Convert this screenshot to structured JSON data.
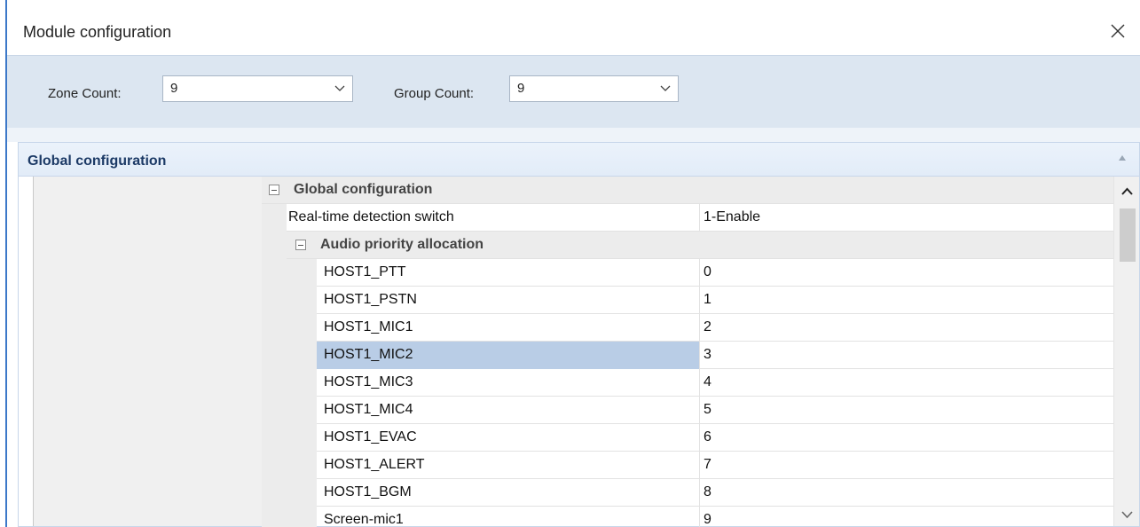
{
  "window": {
    "title": "Module configuration",
    "close_icon": "close-icon"
  },
  "counts": {
    "zone_label": "Zone Count:",
    "zone_value": "9",
    "group_label": "Group Count:",
    "group_value": "9"
  },
  "panel": {
    "title": "Global configuration"
  },
  "grid": {
    "category_global": "Global configuration",
    "realtime_name": "Real-time detection switch",
    "realtime_value": "1-Enable",
    "category_audio": "Audio priority allocation",
    "items": [
      {
        "name": "HOST1_PTT",
        "value": "0"
      },
      {
        "name": "HOST1_PSTN",
        "value": "1"
      },
      {
        "name": "HOST1_MIC1",
        "value": "2"
      },
      {
        "name": "HOST1_MIC2",
        "value": "3"
      },
      {
        "name": "HOST1_MIC3",
        "value": "4"
      },
      {
        "name": "HOST1_MIC4",
        "value": "5"
      },
      {
        "name": "HOST1_EVAC",
        "value": "6"
      },
      {
        "name": "HOST1_ALERT",
        "value": "7"
      },
      {
        "name": "HOST1_BGM",
        "value": "8"
      },
      {
        "name": "Screen-mic1",
        "value": "9"
      }
    ],
    "selected_item": "HOST1_MIC2"
  },
  "colors": {
    "accent": "#3c78c8",
    "selection": "#b9cde6",
    "header_bg": "#dce6f1",
    "panel_title": "#1c3a66"
  }
}
